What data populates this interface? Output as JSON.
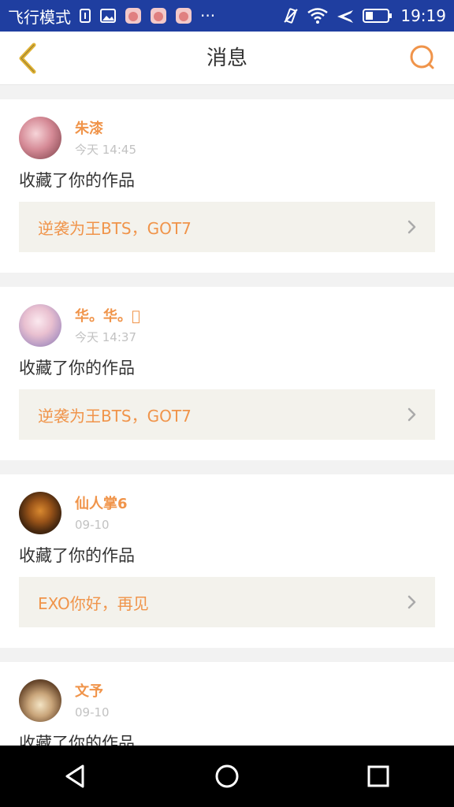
{
  "status_bar": {
    "mode_label": "飞行模式",
    "more_label": "···",
    "time": "19:19"
  },
  "header": {
    "title": "消息"
  },
  "colors": {
    "accent": "#f0944a",
    "status_bar_bg": "#1f3ea0",
    "back_icon": "#e0b233"
  },
  "messages": [
    {
      "username": "朱漆",
      "time": "今天 14:45",
      "action": "收藏了你的作品",
      "work_title": "逆袭为王BTS，GOT7",
      "avatar": "avatar-anime-pink"
    },
    {
      "username": "华。华。\u0000",
      "time": "今天 14:37",
      "action": "收藏了你的作品",
      "work_title": "逆袭为王BTS，GOT7",
      "avatar": "avatar-anime-girl"
    },
    {
      "username": "仙人掌6",
      "time": "09-10",
      "action": "收藏了你的作品",
      "work_title": "EXO你好，再见",
      "avatar": "avatar-tiger"
    },
    {
      "username": "文予",
      "time": "09-10",
      "action": "收藏了你的作品",
      "work_title": "",
      "avatar": "avatar-book"
    }
  ]
}
